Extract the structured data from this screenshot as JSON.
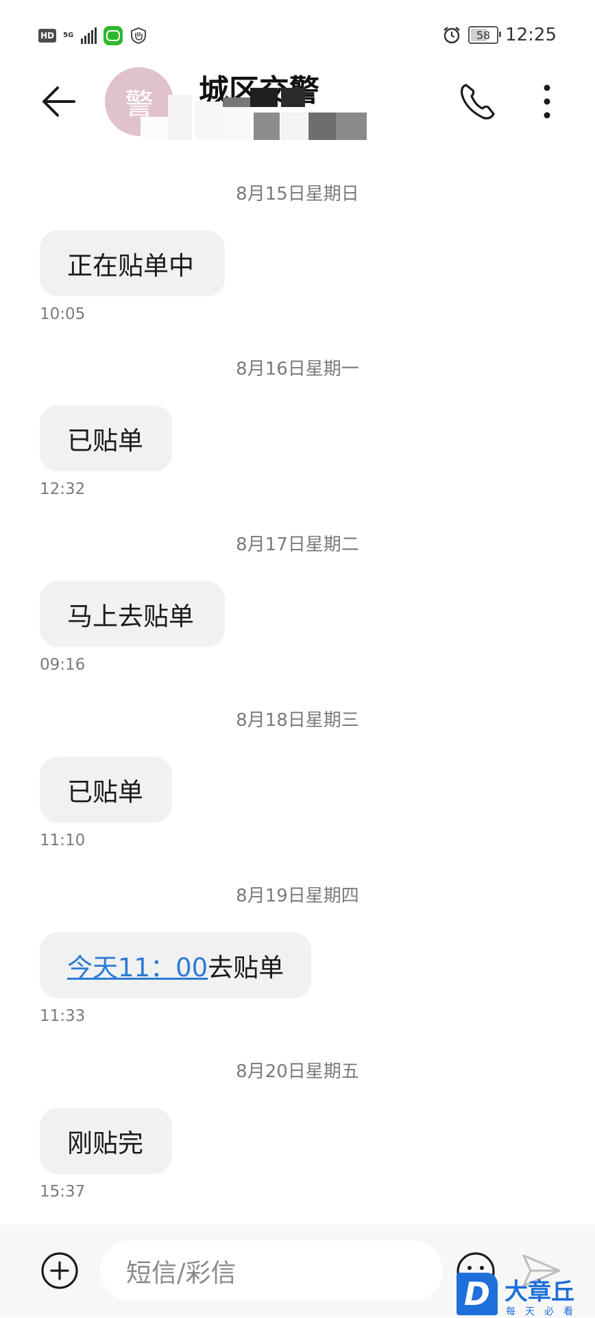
{
  "status_bar": {
    "hd": "HD",
    "network": "5G",
    "time": "12:25",
    "battery": "58"
  },
  "header": {
    "avatar_char": "警",
    "contact_name": "城区交警"
  },
  "messages": [
    {
      "date": "8月15日星期日",
      "text": "正在贴单中",
      "time": "10:05"
    },
    {
      "date": "8月16日星期一",
      "text": "已贴单",
      "time": "12:32"
    },
    {
      "date": "8月17日星期二",
      "text": "马上去贴单",
      "time": "09:16"
    },
    {
      "date": "8月18日星期三",
      "text": "已贴单",
      "time": "11:10"
    },
    {
      "date": "8月19日星期四",
      "link_text": "今天11：00",
      "text": "去贴单",
      "time": "11:33"
    },
    {
      "date": "8月20日星期五",
      "text": "刚贴完",
      "time": "15:37"
    }
  ],
  "composer": {
    "placeholder": "短信/彩信"
  },
  "watermark": {
    "logo_letter": "D",
    "title": "大章丘",
    "subtitle": "每天必看"
  },
  "colors": {
    "link": "#2a7bd6",
    "bubble": "#f1f1f1",
    "avatar": "#dfc2cc",
    "watermark": "#1e6fd9"
  }
}
